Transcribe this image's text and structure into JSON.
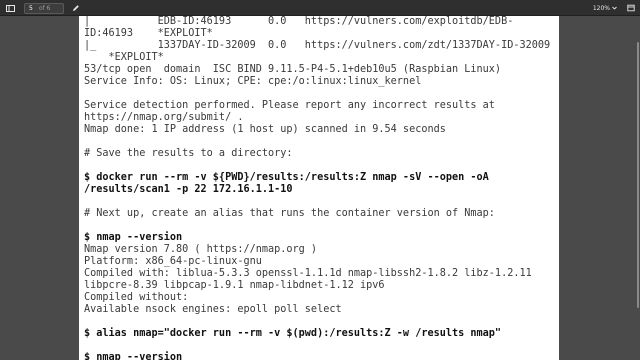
{
  "toolbar": {
    "page_current": "5",
    "page_of": "of 6",
    "zoom": "120%",
    "icons": {
      "sidebar": "sidebar-toggle-icon",
      "edit": "pencil-icon",
      "zoom_dropdown": "chevron-down-icon",
      "more": "more-menu-icon"
    }
  },
  "document": {
    "lines": [
      "|           EDB-ID:46193      0.0   https://vulners.com/exploitdb/EDB-",
      "ID:46193    *EXPLOIT*",
      "|_          1337DAY-ID-32009  0.0   https://vulners.com/zdt/1337DAY-ID-32009",
      "    *EXPLOIT*",
      "53/tcp open  domain  ISC BIND 9.11.5-P4-5.1+deb10u5 (Raspbian Linux)",
      "Service Info: OS: Linux; CPE: cpe:/o:linux:linux_kernel",
      "",
      "Service detection performed. Please report any incorrect results at",
      "https://nmap.org/submit/ .",
      "Nmap done: 1 IP address (1 host up) scanned in 9.54 seconds",
      "",
      "# Save the results to a directory:",
      "",
      "$ docker run --rm -v ${PWD}/results:/results:Z nmap -sV --open -oA",
      "/results/scan1 -p 22 172.16.1.1-10",
      "",
      "# Next up, create an alias that runs the container version of Nmap:",
      "",
      "$ nmap --version",
      "Nmap version 7.80 ( https://nmap.org )",
      "Platform: x86_64-pc-linux-gnu",
      "Compiled with: liblua-5.3.3 openssl-1.1.1d nmap-libssh2-1.8.2 libz-1.2.11",
      "libpcre-8.39 libpcap-1.9.1 nmap-libdnet-1.12 ipv6",
      "Compiled without:",
      "Available nsock engines: epoll poll select",
      "",
      "$ alias nmap=\"docker run --rm -v $(pwd):/results:Z -w /results nmap\"",
      "",
      "$ nmap --version"
    ]
  }
}
